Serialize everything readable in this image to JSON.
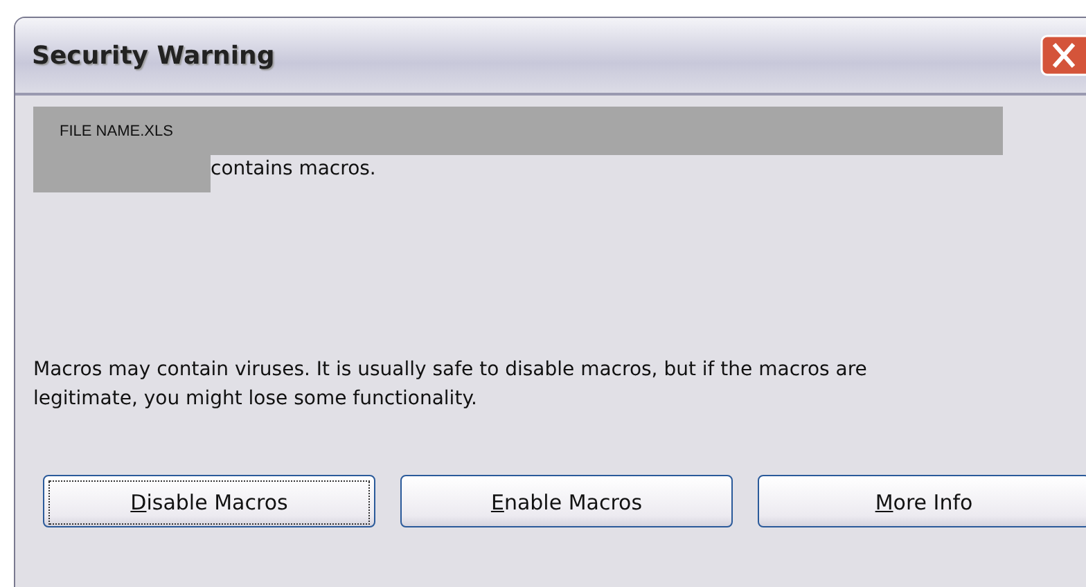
{
  "window": {
    "title": "Security Warning"
  },
  "file_name": "FILE NAME.XLS",
  "file_message": "contains macros.",
  "warning": "Macros may contain viruses. It is usually safe to disable macros, but if the macros are legitimate, you might lose some functionality.",
  "buttons": [
    {
      "label": "Disable Macros",
      "focused": true
    },
    {
      "label": "Enable Macros",
      "focused": false
    },
    {
      "label": "More Info",
      "focused": false
    }
  ]
}
